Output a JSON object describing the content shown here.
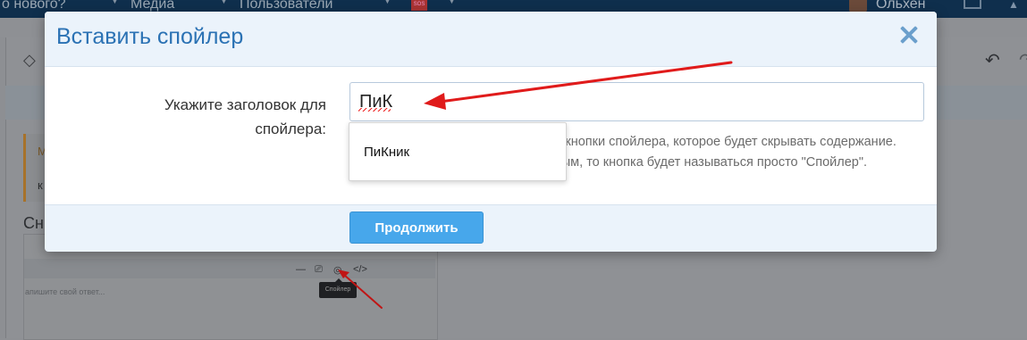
{
  "nav": {
    "items": [
      "о нового?",
      "Медиа",
      "Пользователи"
    ],
    "badge": "SOS",
    "user": "Ольхен"
  },
  "background": {
    "quote_initial": "М",
    "quote_line": "к",
    "heading": "Сн",
    "editor_placeholder": "апишите свой ответ...",
    "tooltip": "Спойлер",
    "tools": [
      "—",
      "⎚",
      "◎",
      "</>"
    ]
  },
  "modal": {
    "title": "Вставить спойлер",
    "label": "Укажите заголовок для спойлера:",
    "input_value": "ПиК",
    "suggestion": "ПиКник",
    "explain": "Здесь можно указать название для кнопки спойлера, которое будет скрывать содержание. Если оставить текстовое поле пустым, то кнопка будет называться просто \"Спойлер\".",
    "submit_label": "Продолжить"
  },
  "colors": {
    "accent": "#2b72b4",
    "button": "#47a7eb",
    "annotation": "#e01b1b",
    "nav_bg": "#0f2f4d"
  }
}
